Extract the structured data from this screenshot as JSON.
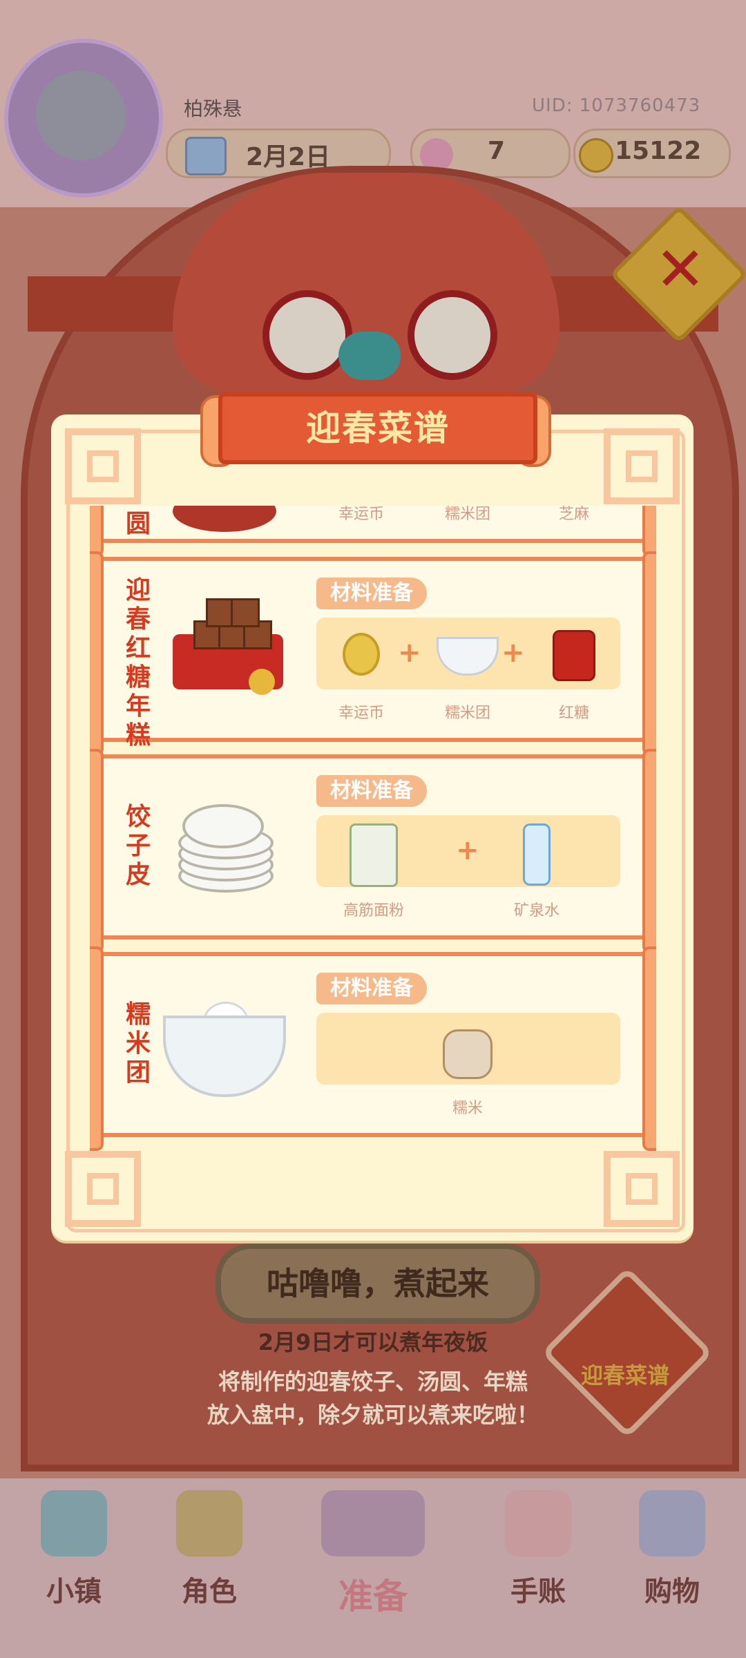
{
  "hud": {
    "player_name": "柏殊悬",
    "uid": "UID: 1073760473",
    "date": "2月2日",
    "flowers": "7",
    "coins": "15122"
  },
  "modal": {
    "title": "迎春菜谱",
    "tag_label": "材料准备",
    "recipes": [
      {
        "name": "汤圆",
        "visible_name": "圆",
        "ingredients": [
          "幸运币",
          "糯米团",
          "芝麻"
        ]
      },
      {
        "name": "迎春红糖年糕",
        "ingredients": [
          "幸运币",
          "糯米团",
          "红糖"
        ]
      },
      {
        "name": "饺子皮",
        "ingredients": [
          "高筋面粉",
          "矿泉水"
        ]
      },
      {
        "name": "糯米团",
        "ingredients": [
          "糯米"
        ]
      }
    ]
  },
  "bottom": {
    "cook_button": "咕噜噜，煮起来",
    "hint_date": "2月9日才可以煮年夜饭",
    "hint_line1": "将制作的迎春饺子、汤圆、年糕",
    "hint_line2": "放入盘中，除夕就可以煮来吃啦！",
    "recipe_badge": "迎春菜谱"
  },
  "nav": {
    "items": [
      "小镇",
      "角色",
      "准备",
      "手账",
      "购物"
    ]
  },
  "colors": {
    "modal_bg": "#fef5d3",
    "card_border": "#f08654",
    "dish_name": "#d63b20",
    "banner": "#e45a34"
  }
}
